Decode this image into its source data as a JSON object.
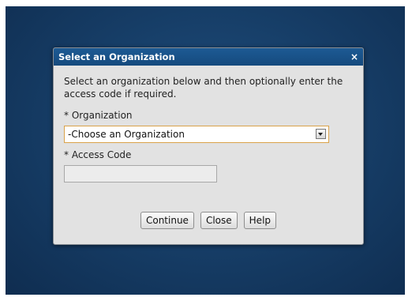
{
  "dialog": {
    "title": "Select an Organization",
    "close_glyph": "×",
    "intro": "Select an organization below and then optionally enter the access code if required.",
    "organization_label": "* Organization",
    "organization_select_value": "-Choose an Organization",
    "access_code_label": "* Access Code",
    "access_code_value": "",
    "buttons": {
      "continue": "Continue",
      "close": "Close",
      "help": "Help"
    }
  },
  "colors": {
    "backdrop": "#173f69",
    "titlebar": "#1a5289",
    "dialog_body": "#e2e2e2",
    "select_border": "#d9a24a"
  },
  "icons": {
    "close": "close-icon",
    "dropdown": "chevron-down-icon"
  }
}
